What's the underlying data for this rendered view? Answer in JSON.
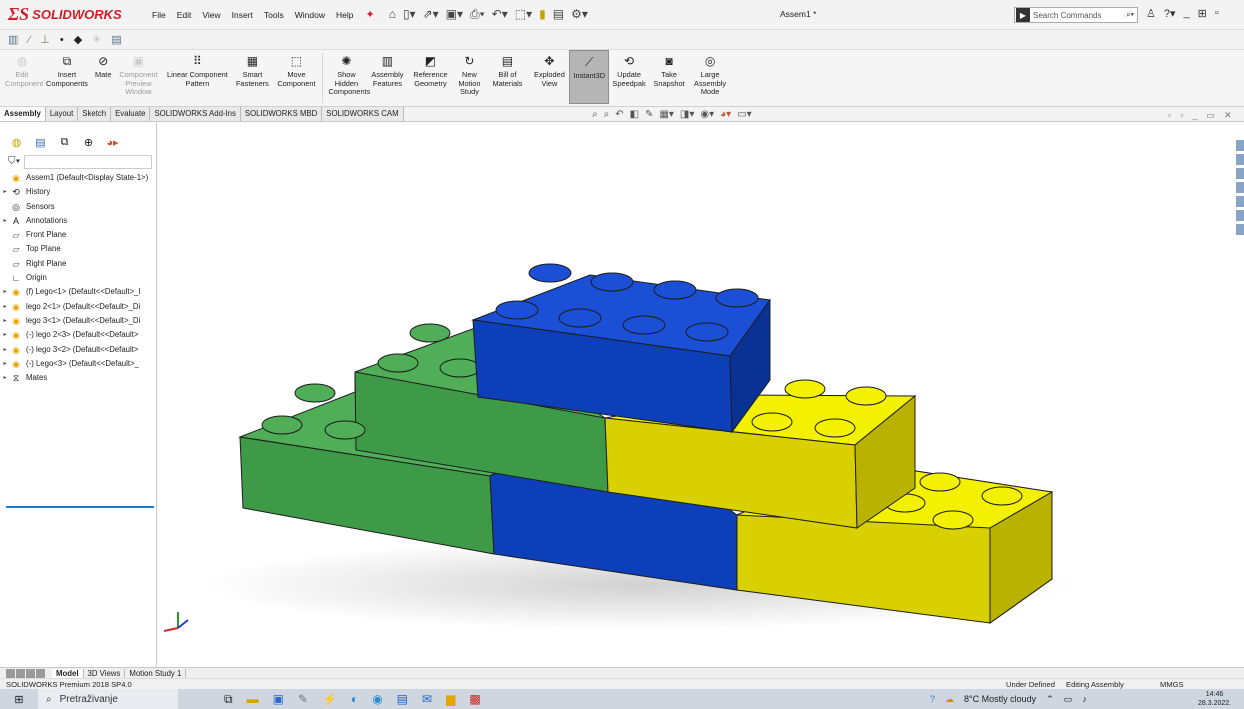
{
  "app": {
    "brand": "SOLIDWORKS",
    "document_title": "Assem1 *"
  },
  "menubar": [
    "File",
    "Edit",
    "View",
    "Insert",
    "Tools",
    "Window",
    "Help"
  ],
  "search": {
    "placeholder": "Search Commands"
  },
  "ribbon": [
    {
      "label": "Edit Component",
      "icon": "edit-component-icon",
      "disabled": true
    },
    {
      "label": "Insert Components",
      "icon": "insert-components-icon"
    },
    {
      "label": "Mate",
      "icon": "mate-icon"
    },
    {
      "label": "Component Preview Window",
      "icon": "component-preview-icon",
      "disabled": true
    },
    {
      "label": "Linear Component Pattern",
      "icon": "linear-pattern-icon"
    },
    {
      "label": "Smart Fasteners",
      "icon": "smart-fasteners-icon"
    },
    {
      "label": "Move Component",
      "icon": "move-component-icon"
    },
    {
      "label": "Show Hidden Components",
      "icon": "show-hidden-icon"
    },
    {
      "label": "Assembly Features",
      "icon": "assembly-features-icon"
    },
    {
      "label": "Reference Geometry",
      "icon": "reference-geometry-icon"
    },
    {
      "label": "New Motion Study",
      "icon": "motion-study-icon"
    },
    {
      "label": "Bill of Materials",
      "icon": "bom-icon"
    },
    {
      "label": "Exploded View",
      "icon": "exploded-view-icon"
    },
    {
      "label": "Instant3D",
      "icon": "instant3d-icon",
      "active": true
    },
    {
      "label": "Update Speedpak",
      "icon": "speedpak-icon"
    },
    {
      "label": "Take Snapshot",
      "icon": "snapshot-icon"
    },
    {
      "label": "Large Assembly Mode",
      "icon": "large-assembly-icon"
    }
  ],
  "tabs": [
    "Assembly",
    "Layout",
    "Sketch",
    "Evaluate",
    "SOLIDWORKS Add-Ins",
    "SOLIDWORKS MBD",
    "SOLIDWORKS CAM"
  ],
  "tree": [
    {
      "label": "Assem1 (Default<Display State-1>)",
      "icon": "assembly-icon",
      "arrow": false
    },
    {
      "label": "History",
      "icon": "history-icon",
      "arrow": true
    },
    {
      "label": "Sensors",
      "icon": "sensors-icon",
      "arrow": false
    },
    {
      "label": "Annotations",
      "icon": "annotations-icon",
      "arrow": true
    },
    {
      "label": "Front Plane",
      "icon": "plane-icon",
      "arrow": false
    },
    {
      "label": "Top Plane",
      "icon": "plane-icon",
      "arrow": false
    },
    {
      "label": "Right Plane",
      "icon": "plane-icon",
      "arrow": false
    },
    {
      "label": "Origin",
      "icon": "origin-icon",
      "arrow": false
    },
    {
      "label": "(f) Lego<1> (Default<<Default>_I",
      "icon": "part-icon",
      "arrow": true
    },
    {
      "label": "lego 2<1> (Default<<Default>_Di",
      "icon": "part-icon",
      "arrow": true
    },
    {
      "label": "lego 3<1> (Default<<Default>_Di",
      "icon": "part-icon",
      "arrow": true
    },
    {
      "label": "(-) lego 2<3> (Default<<Default>",
      "icon": "part-icon",
      "arrow": true
    },
    {
      "label": "(-) lego 3<2> (Default<<Default>",
      "icon": "part-icon",
      "arrow": true
    },
    {
      "label": "(-) Lego<3> (Default<<Default>_",
      "icon": "part-icon",
      "arrow": true
    },
    {
      "label": "Mates",
      "icon": "mates-icon",
      "arrow": true
    }
  ],
  "bottom_tabs": [
    "Model",
    "3D Views",
    "Motion Study 1"
  ],
  "status": {
    "version": "SOLIDWORKS Premium 2018 SP4.0",
    "definition": "Under Defined",
    "mode": "Editing Assembly",
    "units": "MMGS"
  },
  "taskbar": {
    "search_placeholder": "Pretraživanje",
    "weather": "8°C  Mostly cloudy",
    "time": "14:46",
    "date": "28.3.2022."
  },
  "colors": {
    "green": "#3f9a47",
    "blue": "#0d3fb8",
    "yellow": "#d8d000",
    "brand_red": "#d21f27"
  }
}
